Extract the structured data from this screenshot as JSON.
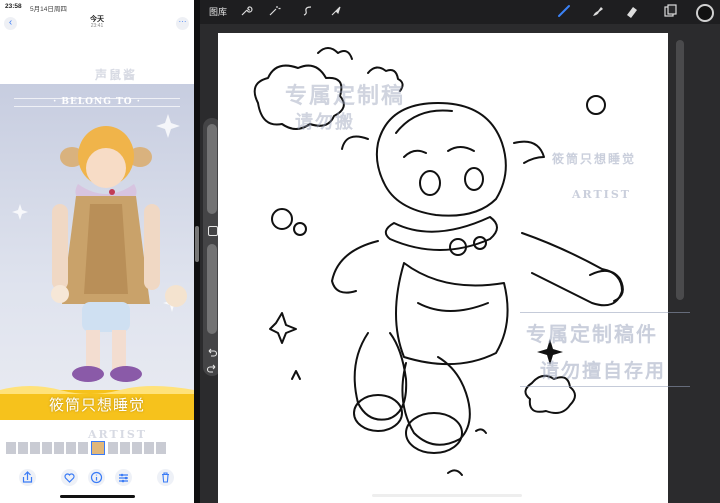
{
  "photos": {
    "status_time": "23:58",
    "status_date": "5月14日周四",
    "nav_title": "今天",
    "nav_subtitle": "23:41",
    "back_label": "‹",
    "more_label": "···",
    "belong_text": "· BELONG TO ·",
    "ghost_top": "声鼠酱",
    "caption": "筱筒只想睡觉",
    "ghost_artist": "ARTIST",
    "actions": [
      "share",
      "favorite",
      "info",
      "adjust",
      "delete"
    ]
  },
  "procreate": {
    "gallery_label": "图库",
    "toolbar_icons": [
      "wrench-icon",
      "magic-wand-icon",
      "selection-icon",
      "transform-icon"
    ],
    "right_tools": [
      "brush-icon",
      "smudge-icon",
      "eraser-icon",
      "layers-icon",
      "color-icon"
    ],
    "watermarks": {
      "exclusive_top": "专属定制稿",
      "no_repost": "请勿搬",
      "small_right": "筱筒只想睡觉",
      "artist_mid": "ARTIST",
      "exclusive_bottom": "专属定制稿件",
      "self_use": "请勿擅自存用"
    },
    "accent_color": "#3b82f6",
    "current_color": "#111111"
  },
  "colors": {
    "caption_band": "#f6c21c",
    "photo_bg": "#c7cde0"
  }
}
